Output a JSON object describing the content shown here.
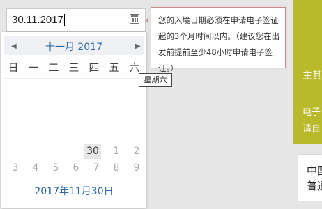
{
  "date_field": {
    "value": "30.11.2017"
  },
  "notice": {
    "text": "您的入境日期必须在申请电子签证起的3个月时间以内。（建议您在出发前提前至少48小时申请电子签证。）"
  },
  "calendar": {
    "prev_label": "◀",
    "next_label": "▶",
    "month_title": "十一月 2017",
    "weekdays": [
      "日",
      "一",
      "二",
      "三",
      "四",
      "五",
      "六"
    ],
    "visible_days": {
      "row5": [
        "30",
        "1",
        "2"
      ],
      "row6": [
        "3",
        "4",
        "5",
        "6",
        "7",
        "8",
        "9"
      ]
    },
    "today_label": "2017年11月30日"
  },
  "weekday_tooltip": "星期六",
  "background_panels": {
    "olive_line1": "主其",
    "olive_line2": "电子",
    "olive_line3": "请自",
    "white_line1": "中国",
    "white_line2": "普通"
  },
  "colors": {
    "accent_blue": "#2d6aa3",
    "olive": "#b9b92b",
    "notice_border": "#cc8888"
  }
}
